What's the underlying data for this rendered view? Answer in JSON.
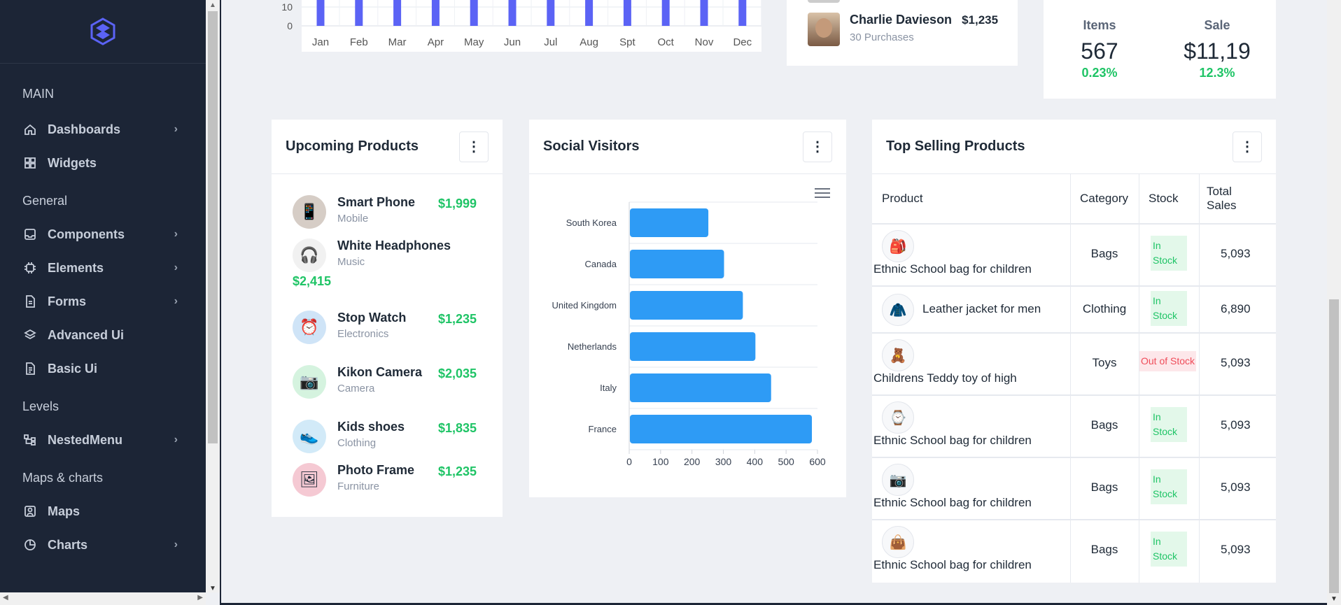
{
  "sidebar": {
    "sections": [
      {
        "heading": "MAIN",
        "items": [
          {
            "label": "Dashboards",
            "icon": "home-icon",
            "chevron": true
          },
          {
            "label": "Widgets",
            "icon": "widgets-icon",
            "chevron": false
          }
        ]
      },
      {
        "heading": "General",
        "items": [
          {
            "label": "Components",
            "icon": "inbox-icon",
            "chevron": true
          },
          {
            "label": "Elements",
            "icon": "chip-icon",
            "chevron": true
          },
          {
            "label": "Forms",
            "icon": "file-icon",
            "chevron": true
          },
          {
            "label": "Advanced Ui",
            "icon": "layers-icon",
            "chevron": false
          },
          {
            "label": "Basic Ui",
            "icon": "document-icon",
            "chevron": false
          }
        ]
      },
      {
        "heading": "Levels",
        "items": [
          {
            "label": "NestedMenu",
            "icon": "tree-icon",
            "chevron": true
          }
        ]
      },
      {
        "heading": "Maps & charts",
        "items": [
          {
            "label": "Maps",
            "icon": "map-icon",
            "chevron": false
          },
          {
            "label": "Charts",
            "icon": "chart-icon",
            "chevron": true
          }
        ]
      }
    ]
  },
  "top_chart": {
    "ticks": [
      "10",
      "0"
    ],
    "months": [
      "Jan",
      "Feb",
      "Mar",
      "Apr",
      "May",
      "Jun",
      "Jul",
      "Aug",
      "Spt",
      "Oct",
      "Nov",
      "Dec"
    ],
    "bar_color": "#5b63f5"
  },
  "top_seller": {
    "name": "Charlie Davieson",
    "amount": "$1,235",
    "purchases": "30 Purchases"
  },
  "stats": [
    {
      "label": "Items",
      "value": "567",
      "change": "0.23%"
    },
    {
      "label": "Sale",
      "value": "$11,19",
      "change": "12.3%"
    }
  ],
  "upcoming": {
    "title": "Upcoming Products",
    "items": [
      {
        "name": "Smart Phone",
        "category": "Mobile",
        "price": "$1,999",
        "icon": "phone-icon"
      },
      {
        "name": "White Headphones",
        "category": "Music",
        "price": "$2,415",
        "icon": "headphones-icon"
      },
      {
        "name": "Stop Watch",
        "category": "Electronics",
        "price": "$1,235",
        "icon": "clock-icon"
      },
      {
        "name": "Kikon Camera",
        "category": "Camera",
        "price": "$2,035",
        "icon": "camera-icon"
      },
      {
        "name": "Kids shoes",
        "category": "Clothing",
        "price": "$1,835",
        "icon": "shoes-icon"
      },
      {
        "name": "Photo Frame",
        "category": "Furniture",
        "price": "$1,235",
        "icon": "frame-icon"
      }
    ]
  },
  "social": {
    "title": "Social Visitors",
    "chart_data": {
      "type": "bar",
      "orientation": "horizontal",
      "categories": [
        "South Korea",
        "Canada",
        "United Kingdom",
        "Netherlands",
        "Italy",
        "France"
      ],
      "values": [
        250,
        300,
        360,
        400,
        450,
        580
      ],
      "xlim": [
        0,
        600
      ],
      "xticks": [
        "0",
        "100",
        "200",
        "300",
        "400",
        "500",
        "600"
      ],
      "color": "#2e9bf5",
      "grid": true
    }
  },
  "top_selling": {
    "title": "Top Selling Products",
    "headers": {
      "product": "Product",
      "category": "Category",
      "stock": "Stock",
      "total": "Total Sales"
    },
    "rows": [
      {
        "product": "Ethnic School bag for children",
        "category": "Bags",
        "stock": "In Stock",
        "total": "5,093",
        "icon": "bag-icon"
      },
      {
        "product": "Leather jacket for men",
        "category": "Clothing",
        "stock": "In Stock",
        "total": "6,890",
        "icon": "jacket-icon"
      },
      {
        "product": "Childrens Teddy toy of high",
        "category": "Toys",
        "stock": "Out of Stock",
        "total": "5,093",
        "icon": "teddy-icon"
      },
      {
        "product": "Ethnic School bag for children",
        "category": "Bags",
        "stock": "In Stock",
        "total": "5,093",
        "icon": "watch-icon"
      },
      {
        "product": "Ethnic School bag for children",
        "category": "Bags",
        "stock": "In Stock",
        "total": "5,093",
        "icon": "camera-icon"
      },
      {
        "product": "Ethnic School bag for children",
        "category": "Bags",
        "stock": "In Stock",
        "total": "5,093",
        "icon": "handbag-icon"
      }
    ]
  }
}
